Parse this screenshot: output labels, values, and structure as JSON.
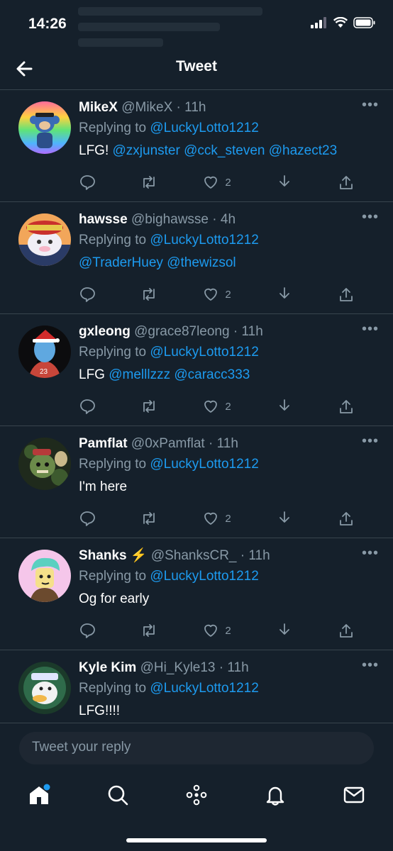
{
  "status_bar": {
    "time": "14:26"
  },
  "header": {
    "title": "Tweet"
  },
  "tweets": [
    {
      "name": "MikeX",
      "handle": "@MikeX",
      "time": "11h",
      "reply_prefix": "Replying to",
      "reply_to": "@LuckyLotto1212",
      "text": "LFG!",
      "mentions": [
        "@zxjunster",
        "@cck_steven",
        "@hazect23"
      ],
      "likes": "2"
    },
    {
      "name": "hawsse",
      "handle": "@bighawsse",
      "time": "4h",
      "reply_prefix": "Replying to",
      "reply_to": "@LuckyLotto1212",
      "text": "",
      "mentions": [
        "@TraderHuey",
        "@thewizsol"
      ],
      "likes": "2"
    },
    {
      "name": "gxleong",
      "handle": "@grace87leong",
      "time": "11h",
      "reply_prefix": "Replying to",
      "reply_to": "@LuckyLotto1212",
      "text": "LFG",
      "mentions": [
        "@melllzzz",
        "@caracc333"
      ],
      "likes": "2"
    },
    {
      "name": "Pamflat",
      "handle": "@0xPamflat",
      "time": "11h",
      "reply_prefix": "Replying to",
      "reply_to": "@LuckyLotto1212",
      "text": "I'm here",
      "mentions": [],
      "likes": "2"
    },
    {
      "name": "Shanks ⚡",
      "handle": "@ShanksCR_",
      "time": "11h",
      "reply_prefix": "Replying to",
      "reply_to": "@LuckyLotto1212",
      "text": "Og for early",
      "mentions": [],
      "likes": "2"
    },
    {
      "name": "Kyle Kim",
      "handle": "@Hi_Kyle13",
      "time": "11h",
      "reply_prefix": "Replying to",
      "reply_to": "@LuckyLotto1212",
      "text": "LFG!!!!",
      "mentions": [],
      "likes": ""
    }
  ],
  "reply_input": {
    "placeholder": "Tweet your reply"
  },
  "icons": {
    "tweet_actions": [
      "reply-icon",
      "retweet-icon",
      "like-icon",
      "download-icon",
      "share-icon"
    ],
    "tabbar": [
      "home-icon",
      "search-icon",
      "spaces-icon",
      "notifications-icon",
      "messages-icon"
    ]
  },
  "colors": {
    "background": "#15202b",
    "accent": "#1d9bf0",
    "secondary_text": "#8899a6",
    "divider": "#38444d"
  }
}
